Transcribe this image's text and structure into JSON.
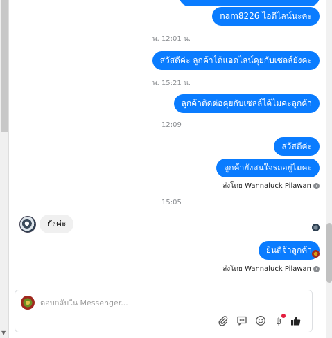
{
  "messages": {
    "m1": "nam8226     ไอดีไลน์นะคะ",
    "ts1": "พ. 12:01 น.",
    "m2": "สวัสดีค่ะ  ลูกค้าได้แอดไลน์คุยกับเซลล์ยังคะ",
    "ts2": "พ. 15:21 น.",
    "m3": "ลูกค้าติดต่อคุยกับเซลล์ได้ไมคะลูกค้า",
    "ts3": "12:09",
    "m4": "สวัสดีค่ะ",
    "m5": "ลูกค้ายังสนใจรถอยู่ไมคะ",
    "sent_by_1_prefix": "ส่งโดย",
    "sent_by_1_name": "Wannaluck Pilawan",
    "ts4": "15:05",
    "incoming_1": "ยังค่ะ",
    "m6": "ยินดีจ้าลูกค้า",
    "sent_by_2_prefix": "ส่งโดย",
    "sent_by_2_name": "Wannaluck Pilawan"
  },
  "composer": {
    "placeholder": "ตอบกลับใน Messenger..."
  },
  "colors": {
    "outgoing_bubble": "#0a7cff",
    "incoming_bubble": "#f0f0f0",
    "timestamp": "#8a8d91",
    "notification_dot": "#e41e3f"
  },
  "icons": [
    "attach-icon",
    "chat-template-icon",
    "emoji-icon",
    "baht-payment-icon",
    "like-icon"
  ]
}
